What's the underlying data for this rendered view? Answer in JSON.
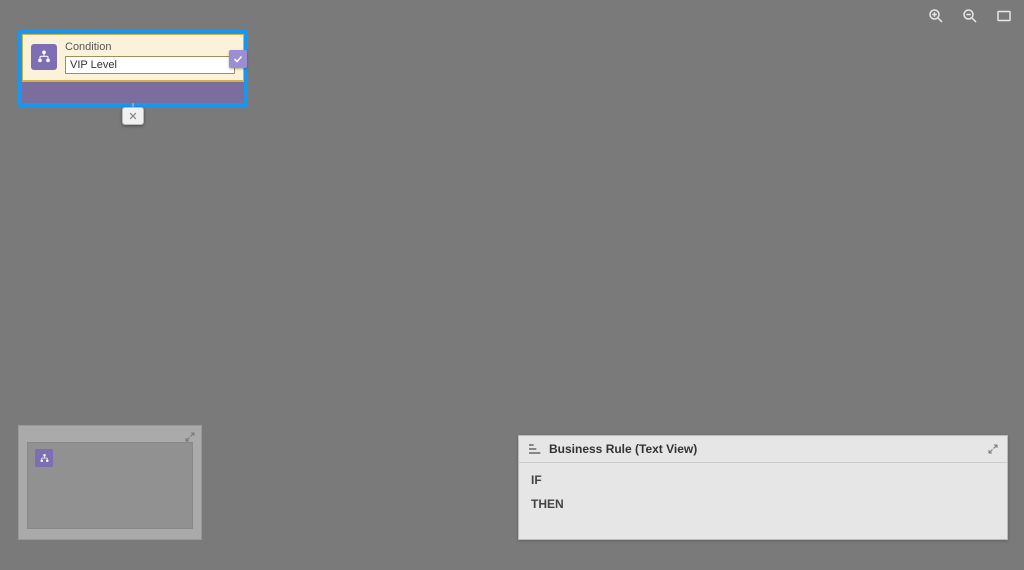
{
  "toolbar": {
    "zoom_in": "zoom-in",
    "zoom_out": "zoom-out",
    "fit": "fit-screen"
  },
  "condition_block": {
    "label": "Condition",
    "value": "VIP Level"
  },
  "text_view": {
    "title": "Business Rule (Text View)",
    "if_keyword": "IF",
    "then_keyword": "THEN"
  }
}
